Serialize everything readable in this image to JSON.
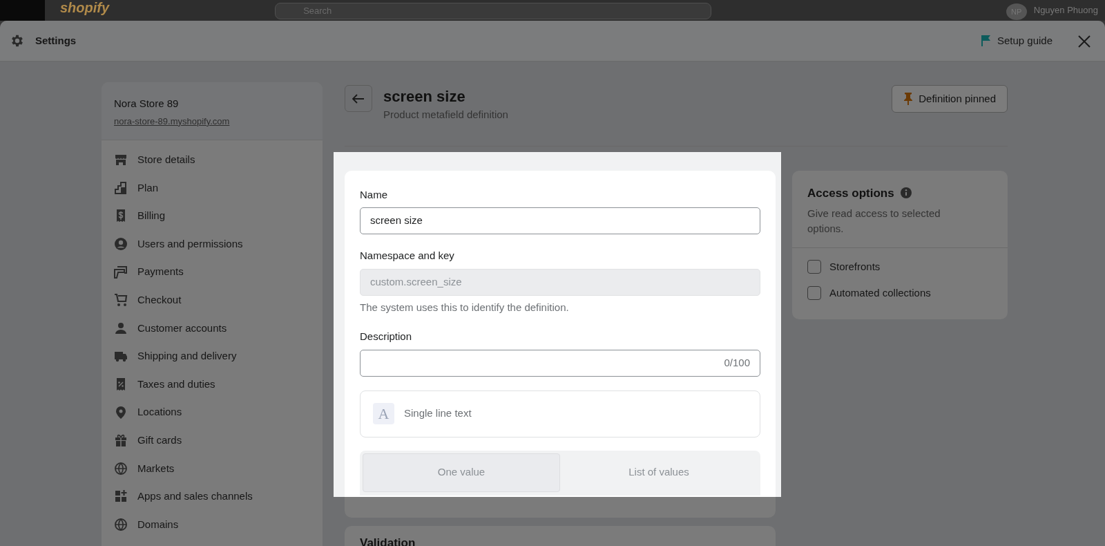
{
  "topbar": {
    "logo": "shopify",
    "search": {
      "placeholder": "Search"
    },
    "avatar": "NP",
    "user": "Nguyen Phuong"
  },
  "modal": {
    "title": "Settings",
    "setup_guide": "Setup guide"
  },
  "store": {
    "name": "Nora Store 89",
    "domain": "nora-store-89.myshopify.com"
  },
  "sidebar": {
    "items": [
      {
        "label": "Store details",
        "selected": false
      },
      {
        "label": "Plan",
        "selected": false
      },
      {
        "label": "Billing",
        "selected": false
      },
      {
        "label": "Users and permissions",
        "selected": false
      },
      {
        "label": "Payments",
        "selected": false
      },
      {
        "label": "Checkout",
        "selected": false
      },
      {
        "label": "Customer accounts",
        "selected": false
      },
      {
        "label": "Shipping and delivery",
        "selected": false
      },
      {
        "label": "Taxes and duties",
        "selected": false
      },
      {
        "label": "Locations",
        "selected": false
      },
      {
        "label": "Gift cards",
        "selected": false
      },
      {
        "label": "Markets",
        "selected": false
      },
      {
        "label": "Apps and sales channels",
        "selected": false
      },
      {
        "label": "Domains",
        "selected": false
      }
    ]
  },
  "page": {
    "title": "screen size",
    "subtitle": "Product metafield definition",
    "pin_button": "Definition pinned"
  },
  "form": {
    "name": {
      "label": "Name",
      "value": "screen size"
    },
    "namespace": {
      "label": "Namespace and key",
      "value": "custom.screen_size",
      "disabled": true,
      "help": "The system uses this to identify the definition."
    },
    "description": {
      "label": "Description",
      "counter": "0/100"
    },
    "type": {
      "icon": "A",
      "label": "Single line text"
    },
    "value_options": [
      {
        "label": "One value",
        "selected": true
      },
      {
        "label": "List of values",
        "selected": false
      }
    ]
  },
  "access": {
    "title": "Access options",
    "description": "Give read access to selected options.",
    "options": [
      {
        "label": "Storefronts",
        "checked": false
      },
      {
        "label": "Automated collections",
        "checked": false
      }
    ]
  },
  "validation": {
    "title": "Validation"
  }
}
